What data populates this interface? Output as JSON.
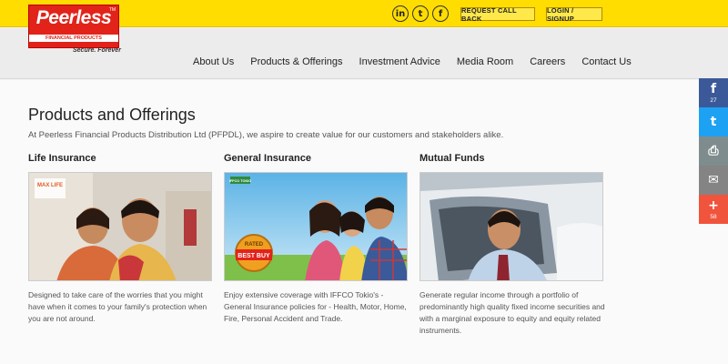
{
  "logo": {
    "name": "Peerless",
    "tm": "TM",
    "subtitle": "FINANCIAL PRODUCTS DISTRIBUTION",
    "tagline": "Secure. Forever"
  },
  "topbar": {
    "social": [
      {
        "icon": "linkedin-icon",
        "glyph": "in"
      },
      {
        "icon": "twitter-icon",
        "glyph": "t"
      },
      {
        "icon": "facebook-icon",
        "glyph": "f"
      }
    ],
    "request_call": "REQUEST CALL BACK",
    "login": "LOGIN / SIGNUP"
  },
  "nav": [
    "About Us",
    "Products & Offerings",
    "Investment Advice",
    "Media Room",
    "Careers",
    "Contact Us"
  ],
  "page": {
    "title": "Products and Offerings",
    "intro": "At Peerless Financial Products Distribution Ltd (PFPDL), we aspire to create value for our customers and stakeholders alike."
  },
  "cards": [
    {
      "title": "Life Insurance",
      "badge": "MAX LIFE",
      "desc": "Designed to take care of the worries that you might have when it comes to your family's protection when you are not around."
    },
    {
      "title": "General Insurance",
      "badge": "IFFCO TOKIO",
      "rated": "RATED",
      "best_buy": "BEST BUY",
      "desc": "Enjoy extensive coverage with IFFCO Tokio's - General Insurance policies for - Health, Motor, Home, Fire, Personal Accident and Trade."
    },
    {
      "title": "Mutual Funds",
      "desc": "Generate regular income through a portfolio of predominantly high quality fixed income securities and with a marginal exposure to equity and equity related instruments."
    }
  ],
  "share": {
    "facebook": {
      "icon": "facebook-icon",
      "glyph": "f",
      "count": "27"
    },
    "twitter": {
      "icon": "twitter-icon",
      "glyph": "t"
    },
    "print": {
      "icon": "print-icon",
      "glyph": "⎙"
    },
    "email": {
      "icon": "email-icon",
      "glyph": "✉"
    },
    "more": {
      "icon": "plus-icon",
      "glyph": "+",
      "count": "58"
    }
  },
  "colors": {
    "accent": "#ffdd00",
    "brand_red": "#e2231a"
  }
}
